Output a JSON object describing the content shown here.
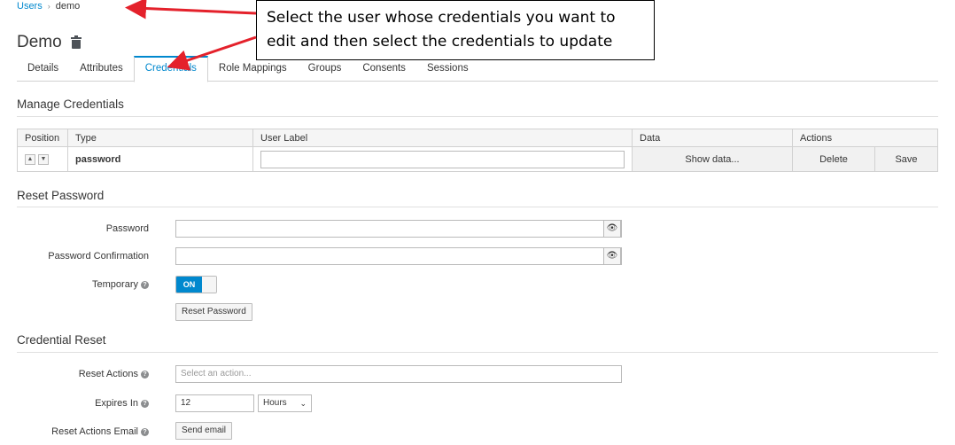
{
  "breadcrumb": {
    "root": "Users",
    "current": "demo"
  },
  "page": {
    "title": "Demo"
  },
  "tabs": [
    {
      "label": "Details",
      "active": false
    },
    {
      "label": "Attributes",
      "active": false
    },
    {
      "label": "Credentials",
      "active": true
    },
    {
      "label": "Role Mappings",
      "active": false
    },
    {
      "label": "Groups",
      "active": false
    },
    {
      "label": "Consents",
      "active": false
    },
    {
      "label": "Sessions",
      "active": false
    }
  ],
  "manage_credentials": {
    "title": "Manage Credentials",
    "columns": {
      "position": "Position",
      "type": "Type",
      "user_label": "User Label",
      "data": "Data",
      "actions": "Actions"
    },
    "row": {
      "type": "password",
      "user_label": "",
      "show_data": "Show data...",
      "delete": "Delete",
      "save": "Save"
    }
  },
  "reset_password": {
    "title": "Reset Password",
    "password_label": "Password",
    "confirm_label": "Password Confirmation",
    "temporary_label": "Temporary",
    "temporary_state": "ON",
    "button": "Reset Password"
  },
  "credential_reset": {
    "title": "Credential Reset",
    "reset_actions_label": "Reset Actions",
    "reset_actions_placeholder": "Select an action...",
    "expires_label": "Expires In",
    "expires_value": "12",
    "expires_unit": "Hours",
    "email_label": "Reset Actions Email",
    "email_button": "Send email"
  },
  "annotation": {
    "line1": "Select the user whose credentials you want to",
    "line2": "edit and then select the credentials to update"
  },
  "colors": {
    "accent": "#0088ce",
    "arrow": "#e4212b"
  }
}
